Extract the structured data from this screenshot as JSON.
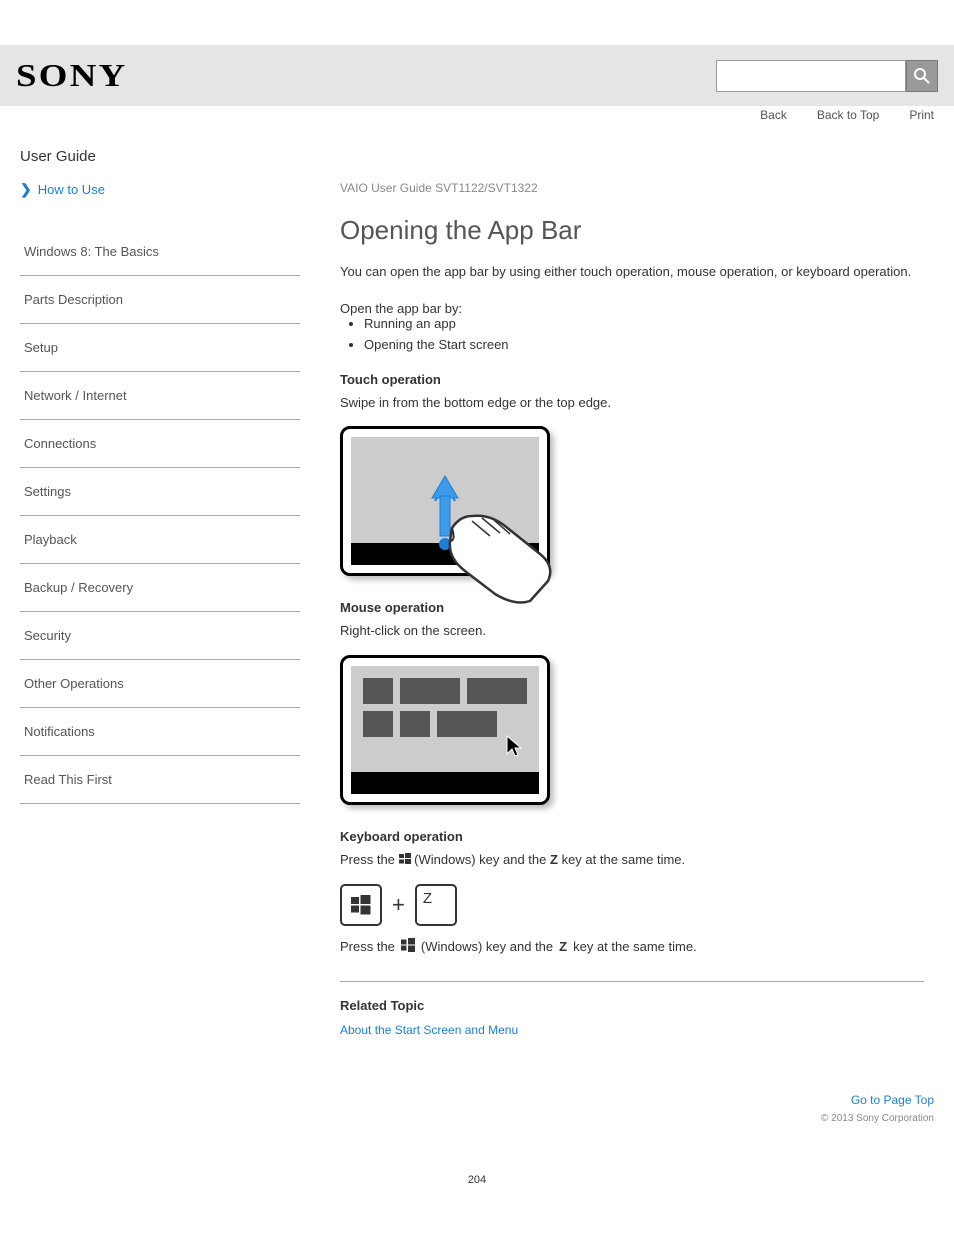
{
  "header": {
    "logo": "SONY",
    "search_placeholder": ""
  },
  "top_links": {
    "back": "Back",
    "top": "Back to Top",
    "print": "Print"
  },
  "user_guide": "User Guide",
  "sidebar": {
    "howto": "How to Use",
    "items": [
      "Windows 8: The Basics",
      "Parts Description",
      "Setup",
      "Network / Internet",
      "Connections",
      "Settings",
      "Playback",
      "Backup / Recovery",
      "Security",
      "Other Operations",
      "Notifications",
      "Read This First"
    ]
  },
  "main": {
    "product": "VAIO User Guide SVT1122/SVT1322",
    "title": "Opening the App Bar",
    "intro": "You can open the app bar by using either touch operation, mouse operation, or keyboard operation.",
    "open_by": "Open the app bar by:",
    "open_options": [
      "Running an app",
      "Opening the Start screen"
    ],
    "methods": {
      "touch": {
        "title": "Touch operation",
        "desc": "Swipe in from the bottom edge or the top edge."
      },
      "mouse": {
        "title": "Mouse operation",
        "desc": "Right-click on the screen."
      },
      "keyboard": {
        "title": "Keyboard operation",
        "note_prefix": "Press the ",
        "note_mid": " (Windows) key and the ",
        "note_key": "Z",
        "note_suffix": " key at the same time."
      }
    },
    "related": {
      "title": "Related Topic",
      "link": "About the Start Screen and Menu"
    }
  },
  "footer": {
    "top": "Go to Page Top",
    "copyright": "© 2013 Sony Corporation",
    "page_number": "204"
  }
}
